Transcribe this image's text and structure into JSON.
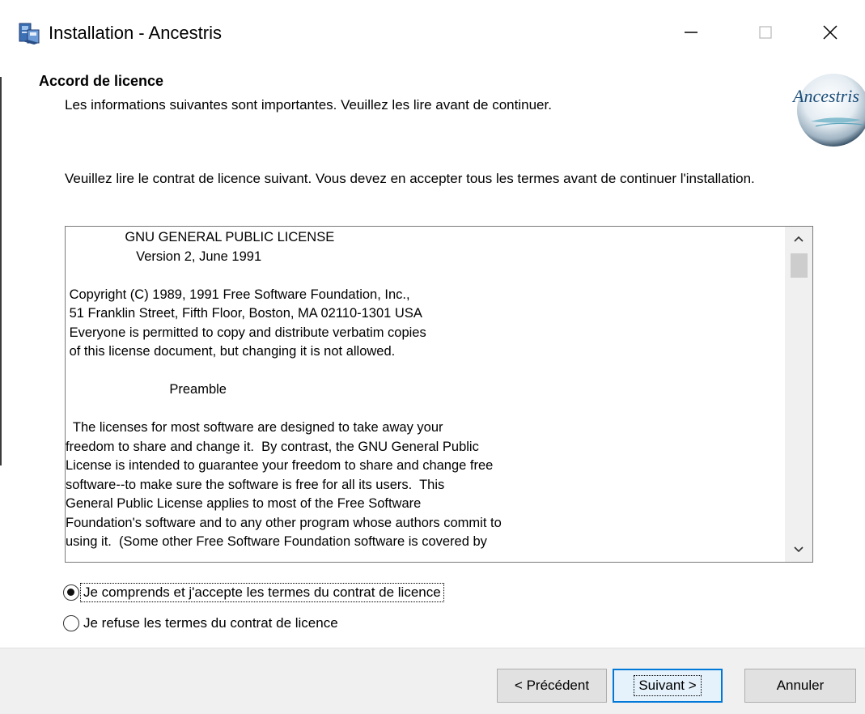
{
  "window": {
    "title": "Installation - Ancestris",
    "app_icon": "setup-package-icon",
    "controls": [
      "minimize-icon",
      "maximize-icon",
      "close-icon"
    ]
  },
  "header": {
    "title": "Accord de licence",
    "subtitle": "Les informations suivantes sont importantes. Veuillez les lire avant de continuer.",
    "logo_text": "Ancestris"
  },
  "intro": "Veuillez lire le contrat de licence suivant. Vous devez en accepter tous les termes avant de continuer l'installation.",
  "license": {
    "lines": [
      "                GNU GENERAL PUBLIC LICENSE",
      "                   Version 2, June 1991",
      "",
      " Copyright (C) 1989, 1991 Free Software Foundation, Inc.,",
      " 51 Franklin Street, Fifth Floor, Boston, MA 02110-1301 USA",
      " Everyone is permitted to copy and distribute verbatim copies",
      " of this license document, but changing it is not allowed.",
      "",
      "                            Preamble",
      "",
      "  The licenses for most software are designed to take away your",
      "freedom to share and change it.  By contrast, the GNU General Public",
      "License is intended to guarantee your freedom to share and change free",
      "software--to make sure the software is free for all its users.  This",
      "General Public License applies to most of the Free Software",
      "Foundation's software and to any other program whose authors commit to",
      "using it.  (Some other Free Software Foundation software is covered by"
    ],
    "scroll_position": 0.0
  },
  "options": {
    "accept_label": "Je comprends et j'accepte les termes du contrat de licence",
    "refuse_label": "Je refuse les termes du contrat de licence",
    "selected": "accept"
  },
  "buttons": {
    "prev_label": "< Précédent",
    "next_label": "Suivant >",
    "cancel_label": "Annuler"
  },
  "colors": {
    "focus_border": "#0078d7",
    "footer_bg": "#f0f0f0",
    "button_bg": "#e1e1e1"
  }
}
